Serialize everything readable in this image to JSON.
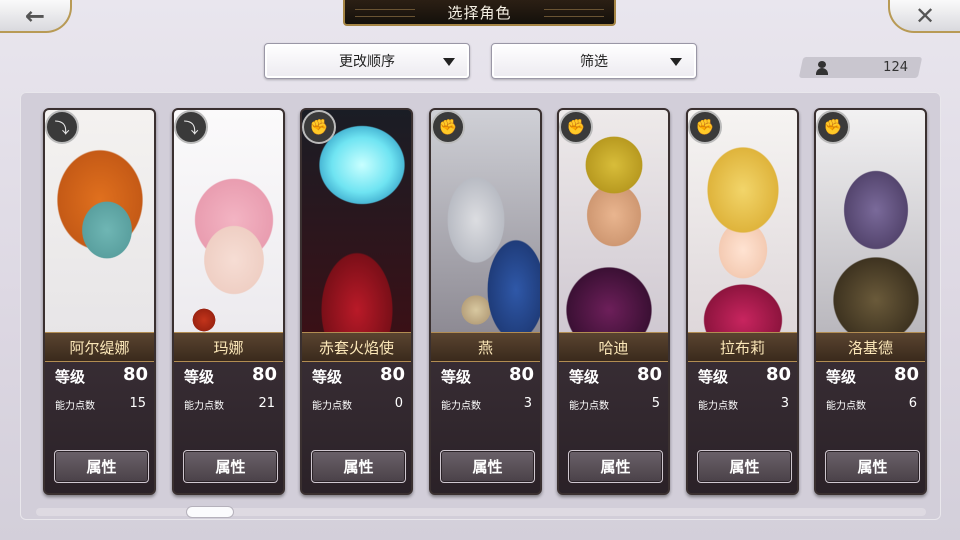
{
  "header": {
    "title": "选择角色",
    "back_glyph": "←",
    "close_glyph": "✕"
  },
  "toolbar": {
    "sort_label": "更改顺序",
    "filter_label": "筛选",
    "count": "124"
  },
  "labels": {
    "level": "等级",
    "ability_points": "能力点数",
    "attributes_button": "属性"
  },
  "characters": [
    {
      "name": "阿尔缇娜",
      "level": "80",
      "ability_points": "15",
      "class_icon": "bow-icon"
    },
    {
      "name": "玛娜",
      "level": "80",
      "ability_points": "21",
      "class_icon": "bow-icon"
    },
    {
      "name": "赤套火焰使",
      "level": "80",
      "ability_points": "0",
      "class_icon": "fist-icon"
    },
    {
      "name": "燕",
      "level": "80",
      "ability_points": "3",
      "class_icon": "fist-icon"
    },
    {
      "name": "哈迪",
      "level": "80",
      "ability_points": "5",
      "class_icon": "fist-icon"
    },
    {
      "name": "拉布莉",
      "level": "80",
      "ability_points": "3",
      "class_icon": "fist-icon"
    },
    {
      "name": "洛基德",
      "level": "80",
      "ability_points": "6",
      "class_icon": "fist-icon"
    }
  ],
  "colors": {
    "gold_trim": "#b28d52",
    "name_text": "#fbe7b8",
    "card_lower": "#2a2127"
  }
}
